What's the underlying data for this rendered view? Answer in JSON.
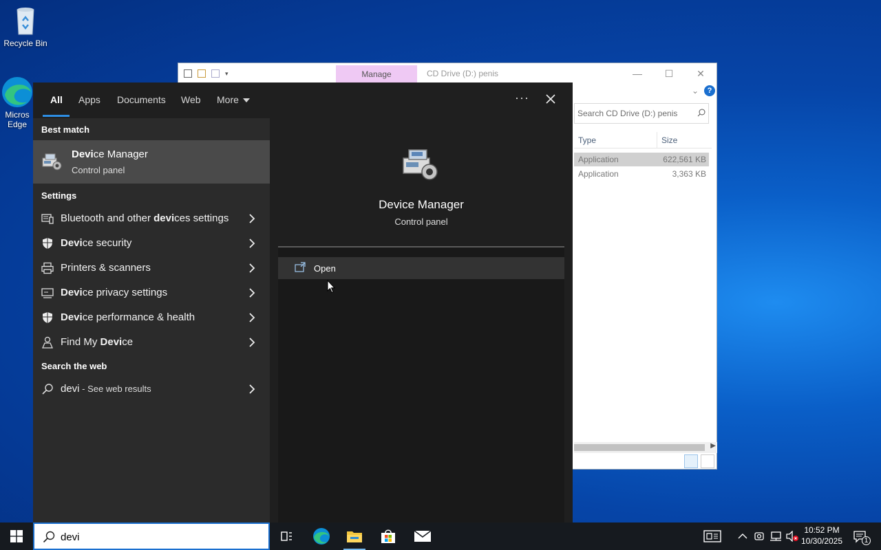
{
  "desktop": {
    "icons": [
      {
        "label": "Recycle Bin"
      },
      {
        "label": "Micros Edge"
      }
    ]
  },
  "explorer": {
    "manage_tab": "Manage",
    "title": "CD Drive (D:) penis",
    "search_placeholder": "Search CD Drive (D:) penis",
    "columns": [
      "Type",
      "Size"
    ],
    "rows": [
      {
        "type": "Application",
        "size": "622,561 KB"
      },
      {
        "type": "Application",
        "size": "3,363 KB"
      }
    ]
  },
  "start_search": {
    "tabs": [
      {
        "label": "All",
        "active": true
      },
      {
        "label": "Apps"
      },
      {
        "label": "Documents"
      },
      {
        "label": "Web"
      },
      {
        "label": "More"
      }
    ],
    "more_options_label": "···",
    "sections": {
      "best_match": "Best match",
      "settings": "Settings",
      "search_web": "Search the web"
    },
    "best_match": {
      "name_highlight": "Devi",
      "name_rest": "ce Manager",
      "subtitle": "Control panel"
    },
    "settings_items": [
      {
        "pre": "Bluetooth and other ",
        "hl": "devi",
        "post": "ces settings",
        "icon": "bluetooth-devices-icon"
      },
      {
        "pre": "",
        "hl": "Devi",
        "post": "ce security",
        "icon": "shield-icon"
      },
      {
        "pre": "Printers & scanners",
        "hl": "",
        "post": "",
        "icon": "printer-icon"
      },
      {
        "pre": "",
        "hl": "Devi",
        "post": "ce privacy settings",
        "icon": "privacy-icon"
      },
      {
        "pre": "",
        "hl": "Devi",
        "post": "ce performance & health",
        "icon": "shield-icon"
      },
      {
        "pre": "Find My ",
        "hl": "Devi",
        "post": "ce",
        "icon": "person-icon"
      }
    ],
    "web_item": {
      "query": "devi",
      "suffix": " - See web results"
    },
    "preview": {
      "name": "Device Manager",
      "subtitle": "Control panel",
      "open_label": "Open"
    }
  },
  "taskbar": {
    "search_value": "devi",
    "apps": [
      "task-view-icon",
      "edge-icon",
      "file-explorer-icon",
      "store-icon",
      "mail-icon"
    ],
    "clock": {
      "time": "10:52 PM",
      "date": "10/30/2025"
    },
    "notification_count": "1",
    "accent": "#1a6fcf"
  }
}
